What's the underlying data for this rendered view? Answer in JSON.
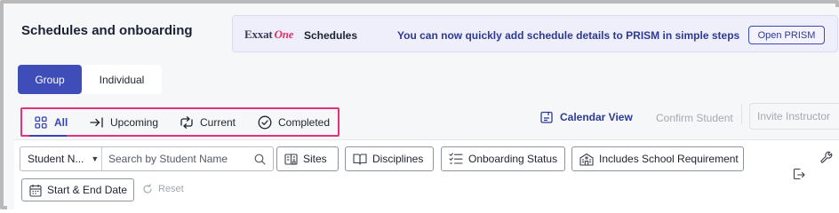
{
  "page": {
    "title": "Schedules and onboarding"
  },
  "banner": {
    "logo_exxat": "Exxat",
    "logo_one": "One",
    "product": "Schedules",
    "message": "You can now quickly add schedule details to PRISM in simple steps",
    "button_label": "Open PRISM"
  },
  "view_toggle": {
    "group": "Group",
    "individual": "Individual",
    "selected": "Group"
  },
  "status_tabs": {
    "selected": "All",
    "items": [
      {
        "label": "All",
        "icon": "grid-icon"
      },
      {
        "label": "Upcoming",
        "icon": "arrow-right-to-line-icon"
      },
      {
        "label": "Current",
        "icon": "cycle-arrows-icon"
      },
      {
        "label": "Completed",
        "icon": "check-circle-icon"
      }
    ]
  },
  "actions": {
    "calendar_view": "Calendar View",
    "confirm_student": "Confirm Student",
    "invite_instructor": "Invite Instructor"
  },
  "filters": {
    "search_field_select": "Student N...",
    "search_placeholder": "Search by Student Name",
    "sites": "Sites",
    "disciplines": "Disciplines",
    "onboarding_status": "Onboarding Status",
    "school_requirement": "Includes School Requirement",
    "date_range": "Start & End Date",
    "reset": "Reset"
  },
  "colors": {
    "accent": "#3f4db8",
    "highlight_border": "#e2337a",
    "banner_bg": "#efeefb",
    "link_blue": "#2c3a96",
    "disabled_text": "#a5a9b3"
  }
}
